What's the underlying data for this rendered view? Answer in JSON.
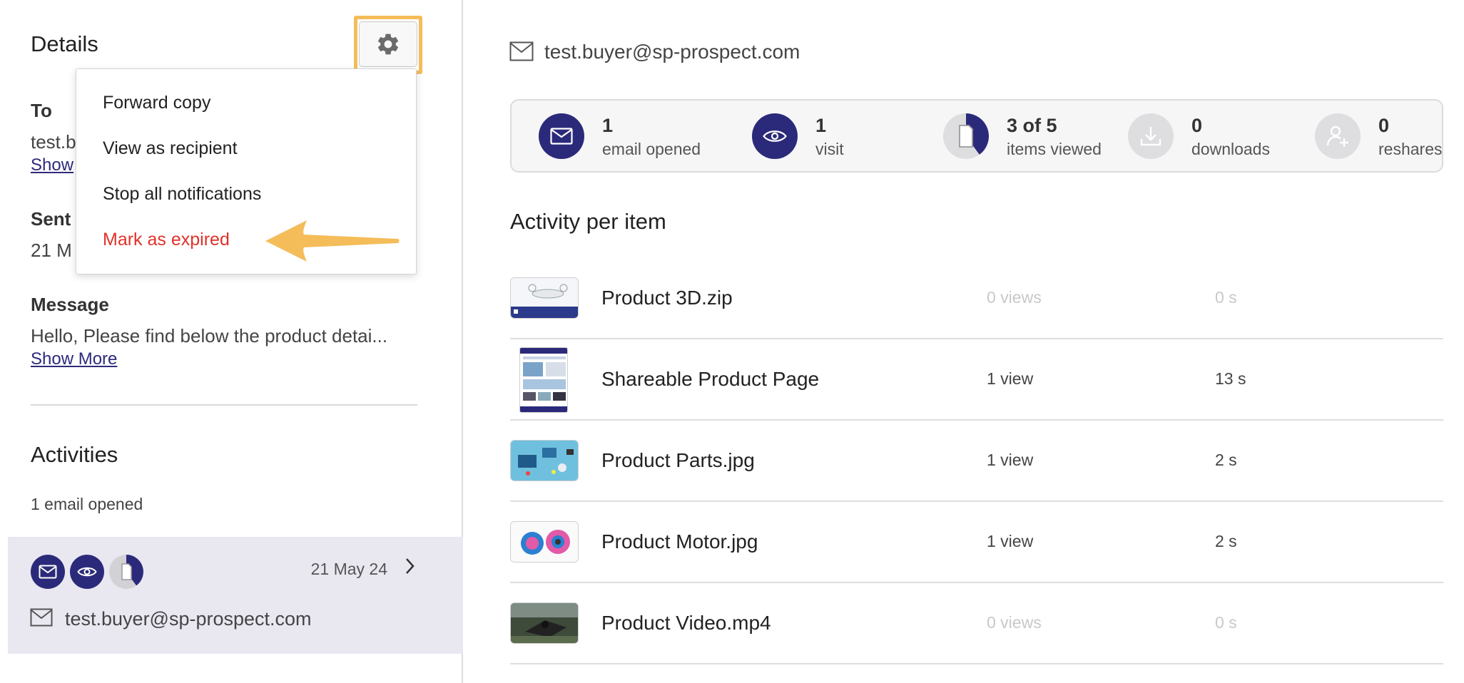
{
  "details": {
    "title": "Details",
    "to_label": "To",
    "to_value": "test.b",
    "to_show_link": "Show",
    "sent_label": "Sent",
    "sent_value": "21 M",
    "message_label": "Message",
    "message_value": "Hello, Please find below the product detai...",
    "message_show_more": "Show More"
  },
  "menu": {
    "items": [
      {
        "label": "Forward copy"
      },
      {
        "label": "View as recipient"
      },
      {
        "label": "Stop all notifications"
      },
      {
        "label": "Mark as expired"
      }
    ]
  },
  "activities": {
    "title": "Activities",
    "subtitle": "1 email opened",
    "card": {
      "date": "21 May 24",
      "email": "test.buyer@sp-prospect.com",
      "icons": [
        "mail-icon",
        "eye-icon",
        "document-progress-icon"
      ]
    }
  },
  "recipient": {
    "email": "test.buyer@sp-prospect.com"
  },
  "stats": [
    {
      "value": "1",
      "label": "email opened",
      "icon": "mail-icon"
    },
    {
      "value": "1",
      "label": "visit",
      "icon": "eye-icon"
    },
    {
      "value": "3 of 5",
      "label": "items viewed",
      "icon": "document-progress-icon",
      "progress": 0.6
    },
    {
      "value": "0",
      "label": "downloads",
      "icon": "download-icon"
    },
    {
      "value": "0",
      "label": "reshares",
      "icon": "add-user-icon"
    }
  ],
  "activity_per_item": {
    "title": "Activity per item",
    "items": [
      {
        "name": "Product 3D.zip",
        "views": "0 views",
        "time": "0 s",
        "inactive": true
      },
      {
        "name": "Shareable Product Page",
        "views": "1 view",
        "time": "13 s",
        "inactive": false
      },
      {
        "name": "Product Parts.jpg",
        "views": "1 view",
        "time": "2 s",
        "inactive": false
      },
      {
        "name": "Product Motor.jpg",
        "views": "1 view",
        "time": "2 s",
        "inactive": false
      },
      {
        "name": "Product Video.mp4",
        "views": "0 views",
        "time": "0 s",
        "inactive": true
      }
    ]
  },
  "colors": {
    "navy": "#2b2a7a",
    "highlight": "#f4bd5a",
    "danger": "#e0322a",
    "card_bg": "#e9e8f1"
  }
}
